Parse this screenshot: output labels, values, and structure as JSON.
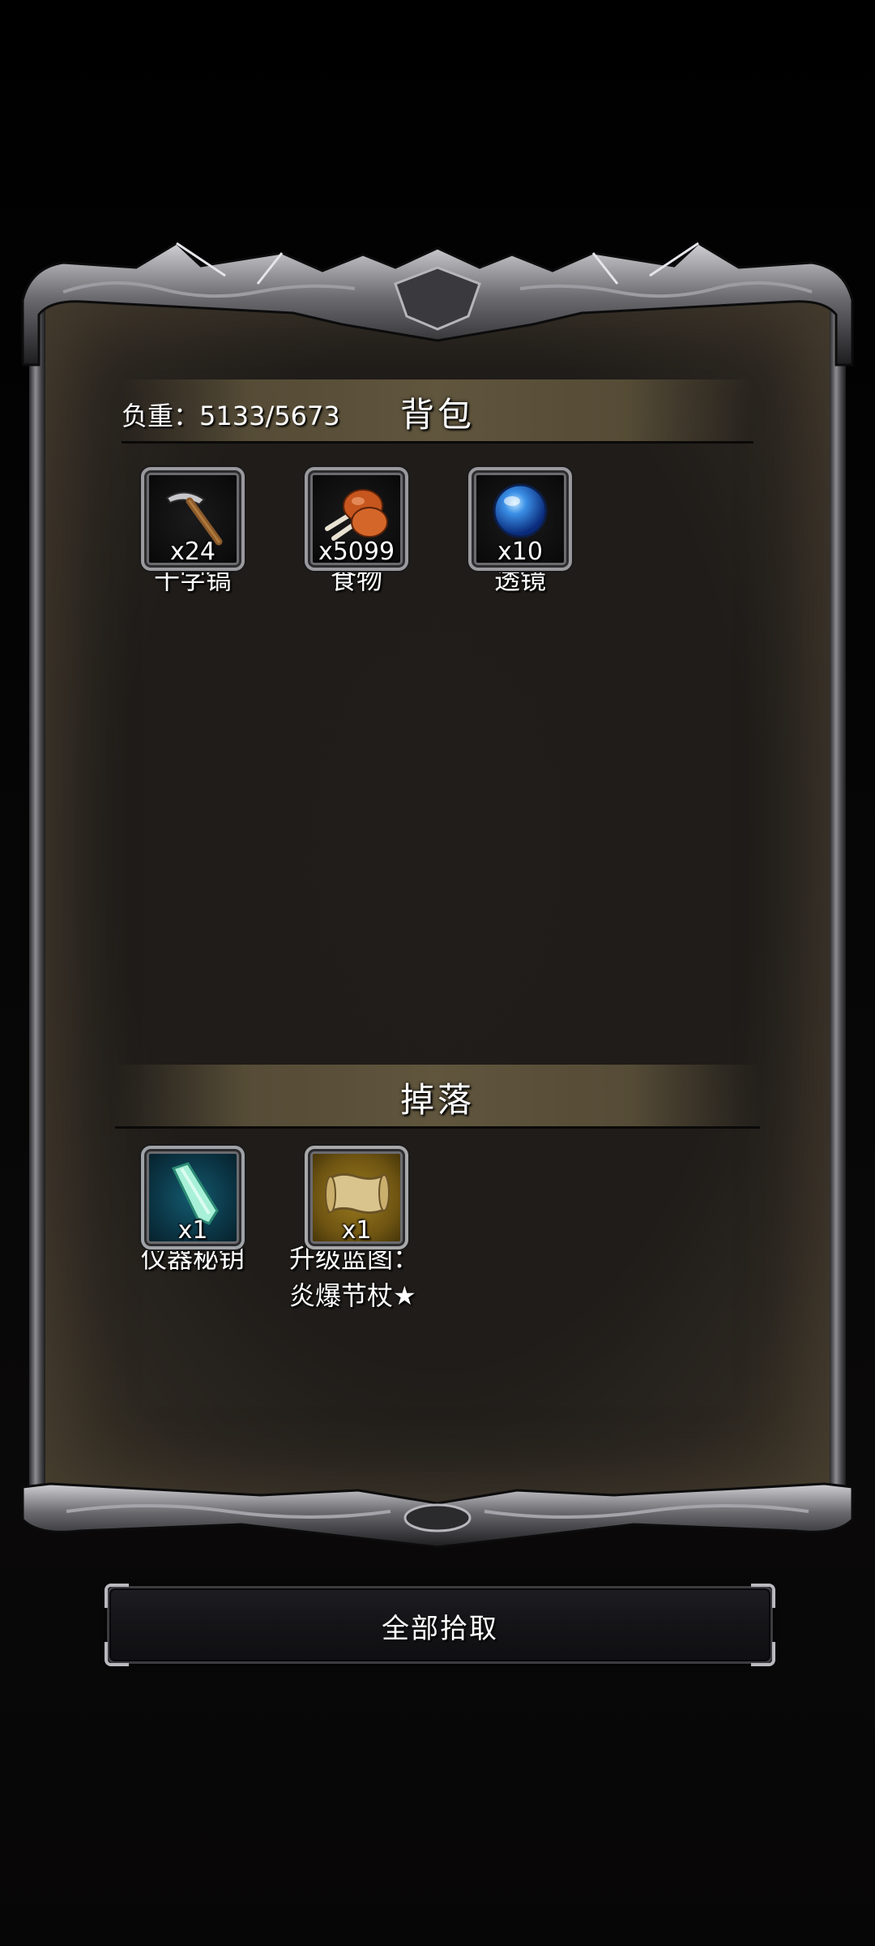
{
  "backpack": {
    "title": "背包",
    "weight_label": "负重：5133/5673",
    "items": [
      {
        "name": "十字镐",
        "count": "x24",
        "icon": "pickaxe-icon"
      },
      {
        "name": "食物",
        "count": "x5099",
        "icon": "meat-icon"
      },
      {
        "name": "透镜",
        "count": "x10",
        "icon": "lens-orb-icon"
      }
    ]
  },
  "drops": {
    "title": "掉落",
    "items": [
      {
        "name": "仪器秘钥",
        "count": "x1",
        "icon": "crystal-key-icon",
        "slot_color": "#0b3646"
      },
      {
        "name_line1": "升级蓝图：",
        "name_line2": "炎爆节杖★",
        "count": "x1",
        "icon": "scroll-blueprint-icon",
        "slot_color": "#6e5412"
      }
    ]
  },
  "actions": {
    "pickup_all_label": "全部拾取"
  }
}
